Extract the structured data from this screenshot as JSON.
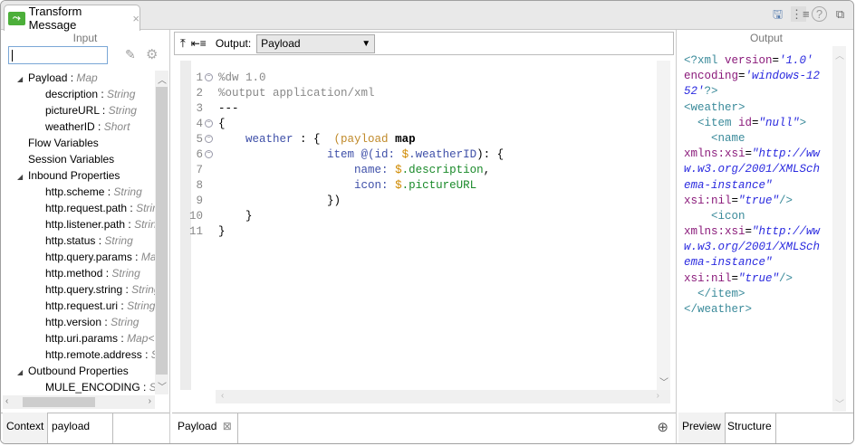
{
  "tab": {
    "title": "Transform Message",
    "close": "×"
  },
  "top_icons": [
    "save-icon",
    "tree-icon",
    "help-icon",
    "restore-icon"
  ],
  "input": {
    "title": "Input",
    "search_value": "",
    "tree": [
      {
        "label": "Payload",
        "type": "Map",
        "level": 0,
        "expanded": true
      },
      {
        "label": "description",
        "type": "String",
        "level": 2
      },
      {
        "label": "pictureURL",
        "type": "String",
        "level": 2
      },
      {
        "label": "weatherID",
        "type": "Short",
        "level": 2
      },
      {
        "label": "Flow Variables",
        "level": 1
      },
      {
        "label": "Session Variables",
        "level": 1
      },
      {
        "label": "Inbound Properties",
        "level": 0,
        "expanded": true
      },
      {
        "label": "http.scheme",
        "type": "String",
        "level": 2
      },
      {
        "label": "http.request.path",
        "type": "String",
        "level": 2
      },
      {
        "label": "http.listener.path",
        "type": "String",
        "level": 2
      },
      {
        "label": "http.status",
        "type": "String",
        "level": 2
      },
      {
        "label": "http.query.params",
        "type": "Map",
        "level": 2
      },
      {
        "label": "http.method",
        "type": "String",
        "level": 2
      },
      {
        "label": "http.query.string",
        "type": "String",
        "level": 2
      },
      {
        "label": "http.request.uri",
        "type": "String",
        "level": 2
      },
      {
        "label": "http.version",
        "type": "String",
        "level": 2
      },
      {
        "label": "http.uri.params",
        "type": "Map<",
        "level": 2
      },
      {
        "label": "http.remote.address",
        "type": "String",
        "level": 2
      },
      {
        "label": "Outbound Properties",
        "level": 0,
        "expanded": true
      },
      {
        "label": "MULE_ENCODING",
        "type": "String",
        "level": 2
      }
    ],
    "tabs": [
      "Context",
      "payload"
    ]
  },
  "editor": {
    "output_label": "Output:",
    "output_value": "Payload",
    "lines": [
      {
        "n": "1",
        "fold": true,
        "tokens": [
          [
            "%dw 1.0",
            "#888"
          ]
        ]
      },
      {
        "n": "2",
        "tokens": [
          [
            "%output application/xml",
            "#888"
          ]
        ]
      },
      {
        "n": "3",
        "tokens": [
          [
            "---",
            "#000"
          ]
        ]
      },
      {
        "n": "4",
        "fold": true,
        "tokens": [
          [
            "{",
            "#000"
          ]
        ]
      },
      {
        "n": "5",
        "fold": true,
        "tokens": [
          [
            "    weather",
            "#3e4fa8"
          ],
          [
            " : {  ",
            "#000"
          ],
          [
            "(payload",
            "#c08a2a"
          ],
          [
            " map",
            "#000",
            "b"
          ]
        ]
      },
      {
        "n": "6",
        "fold": true,
        "tokens": [
          [
            "                item @(id: ",
            "#3e4fa8"
          ],
          [
            "$",
            "#d08a00"
          ],
          [
            ".weatherID",
            "#3e4fa8"
          ],
          [
            "): {",
            "#000"
          ]
        ]
      },
      {
        "n": "7",
        "tokens": [
          [
            "                    name: ",
            "#3e4fa8"
          ],
          [
            "$",
            "#d08a00"
          ],
          [
            ".description",
            "#1a8a2a"
          ],
          [
            ",",
            "#000"
          ]
        ]
      },
      {
        "n": "8",
        "tokens": [
          [
            "                    icon: ",
            "#3e4fa8"
          ],
          [
            "$",
            "#d08a00"
          ],
          [
            ".pictureURL",
            "#1a8a2a"
          ]
        ]
      },
      {
        "n": "9",
        "tokens": [
          [
            "                })",
            "#000"
          ]
        ]
      },
      {
        "n": "10",
        "tokens": [
          [
            "    }",
            "#000"
          ]
        ]
      },
      {
        "n": "11",
        "tokens": [
          [
            "}",
            "#000"
          ]
        ]
      }
    ],
    "tabs": [
      "Payload"
    ],
    "tab_close": "⊠"
  },
  "output": {
    "title": "Output",
    "lines": [
      [
        [
          "<?xml ",
          "#3a8a9a"
        ],
        [
          "version",
          "#8a1a7a"
        ],
        [
          "=",
          "#000"
        ],
        [
          "'1.0'",
          "#2a2adf",
          "i"
        ]
      ],
      [
        [
          "encoding",
          "#8a1a7a"
        ],
        [
          "=",
          "#000"
        ],
        [
          "'windows-12",
          "#2a2adf",
          "i"
        ]
      ],
      [
        [
          "52'",
          "#2a2adf",
          "i"
        ],
        [
          "?>",
          "#3a8a9a"
        ]
      ],
      [
        [
          "<weather>",
          "#3a8a9a"
        ]
      ],
      [
        [
          "  <item ",
          "#3a8a9a"
        ],
        [
          "id",
          "#8a1a7a"
        ],
        [
          "=",
          "#000"
        ],
        [
          "\"null\"",
          "#2a2adf",
          "i"
        ],
        [
          ">",
          "#3a8a9a"
        ]
      ],
      [
        [
          "    <name",
          "#3a8a9a"
        ]
      ],
      [
        [
          "xmlns:xsi",
          "#8a1a7a"
        ],
        [
          "=",
          "#000"
        ],
        [
          "\"http://ww",
          "#2a2adf",
          "i"
        ]
      ],
      [
        [
          "w.w3.org/2001/XMLSch",
          "#2a2adf",
          "i"
        ]
      ],
      [
        [
          "ema-instance\"",
          "#2a2adf",
          "i"
        ]
      ],
      [
        [
          "xsi:nil",
          "#8a1a7a"
        ],
        [
          "=",
          "#000"
        ],
        [
          "\"true\"",
          "#2a2adf",
          "i"
        ],
        [
          "/>",
          "#3a8a9a"
        ]
      ],
      [
        [
          "    <icon",
          "#3a8a9a"
        ]
      ],
      [
        [
          "xmlns:xsi",
          "#8a1a7a"
        ],
        [
          "=",
          "#000"
        ],
        [
          "\"http://ww",
          "#2a2adf",
          "i"
        ]
      ],
      [
        [
          "w.w3.org/2001/XMLSch",
          "#2a2adf",
          "i"
        ]
      ],
      [
        [
          "ema-instance\"",
          "#2a2adf",
          "i"
        ]
      ],
      [
        [
          "xsi:nil",
          "#8a1a7a"
        ],
        [
          "=",
          "#000"
        ],
        [
          "\"true\"",
          "#2a2adf",
          "i"
        ],
        [
          "/>",
          "#3a8a9a"
        ]
      ],
      [
        [
          "  </item>",
          "#3a8a9a"
        ]
      ],
      [
        [
          "</weather>",
          "#3a8a9a"
        ]
      ]
    ],
    "tabs": [
      "Preview",
      "Structure"
    ]
  }
}
